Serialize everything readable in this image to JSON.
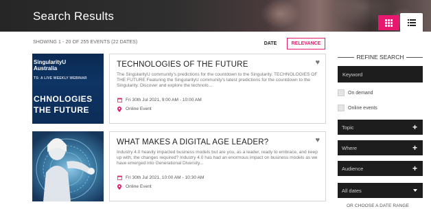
{
  "header": {
    "title": "Search Results",
    "view_grid_icon": "grid-icon",
    "view_list_icon": "list-icon",
    "accent": "#e6196e"
  },
  "results": {
    "showing": "SHOWING 1 - 20 OF 255 EVENTS (22 DATES)",
    "sort_date": "DATE",
    "sort_relevance": "RELEVANCE"
  },
  "events": [
    {
      "image_brand": "SingularityU\nAustralia",
      "image_sub": "TS: A LIVE WEEKLY WEBINAR",
      "image_big": "CHNOLOGIES\nTHE FUTURE",
      "title": "TECHNOLOGIES OF THE FUTURE",
      "description": "The SingularityU community's predictions for the countdown to the Singularity. TECHNOLOGIES OF THE FUTURE Featuring the SingularityU community's latest predictions for the countdown to the Singularity. Discover and explore the technolo...",
      "date": "Fri 30th Jul 2021, 9:00 AM - 10:00 AM",
      "location": "Online Event"
    },
    {
      "title": "WHAT MAKES A DIGITAL AGE LEADER?",
      "description": "Industry 4.0 heavily impacted business models but are you, as a leader, ready to embrace, and keep up with, the changes required? Industry 4.0 has had an enormous impact on business models as we have emerged into Generational Diversity...",
      "date": "Fri 30th Jul 2021, 10:00 AM - 10:30 AM",
      "location": "Online Event"
    }
  ],
  "sidebar": {
    "refine_title": "REFINE SEARCH",
    "keyword_placeholder": "Keyword",
    "on_demand": "On demand",
    "online_events": "Online events",
    "topic": "Topic",
    "where": "Where",
    "audience": "Audience",
    "all_dates": "All dates",
    "or_choose": "OR CHOOSE A DATE RANGE"
  }
}
